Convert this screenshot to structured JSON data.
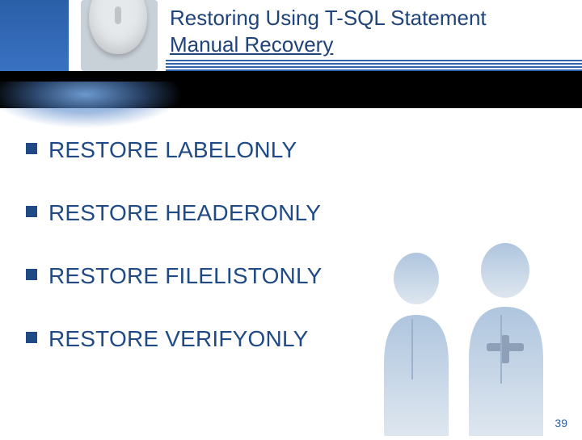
{
  "header": {
    "title_line1": "Restoring Using T-SQL Statement",
    "title_line2": "Manual Recovery"
  },
  "bullets": [
    "RESTORE LABELONLY",
    "RESTORE HEADERONLY",
    "RESTORE FILELISTONLY",
    "RESTORE VERIFYONLY"
  ],
  "page_number": "39"
}
